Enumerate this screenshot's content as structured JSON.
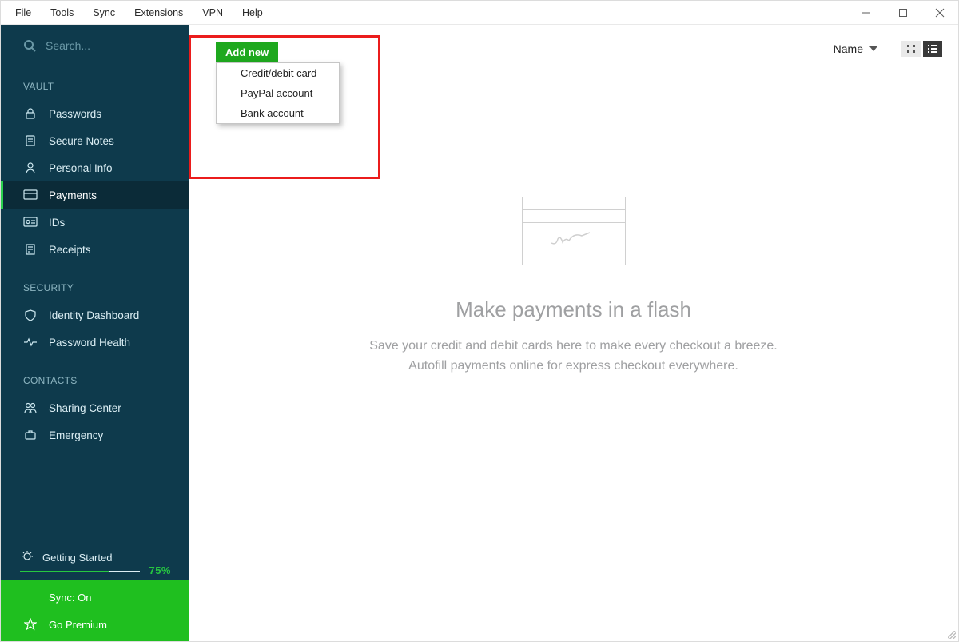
{
  "menubar": {
    "items": [
      "File",
      "Tools",
      "Sync",
      "Extensions",
      "VPN",
      "Help"
    ]
  },
  "search": {
    "placeholder": "Search..."
  },
  "sidebar": {
    "sections": {
      "vault": {
        "label": "VAULT",
        "items": [
          "Passwords",
          "Secure Notes",
          "Personal Info",
          "Payments",
          "IDs",
          "Receipts"
        ],
        "active_index": 3
      },
      "security": {
        "label": "SECURITY",
        "items": [
          "Identity Dashboard",
          "Password Health"
        ]
      },
      "contacts": {
        "label": "CONTACTS",
        "items": [
          "Sharing Center",
          "Emergency"
        ]
      }
    },
    "getting_started": {
      "label": "Getting Started",
      "percent_label": "75%"
    },
    "bottom": {
      "sync": "Sync: On",
      "premium": "Go Premium"
    }
  },
  "content": {
    "add_new_label": "Add new",
    "add_new_menu": [
      "Credit/debit card",
      "PayPal account",
      "Bank account"
    ],
    "sort_label": "Name",
    "empty": {
      "title": "Make payments in a flash",
      "body": "Save your credit and debit cards here to make every checkout a breeze. Autofill payments online for express checkout everywhere."
    }
  }
}
